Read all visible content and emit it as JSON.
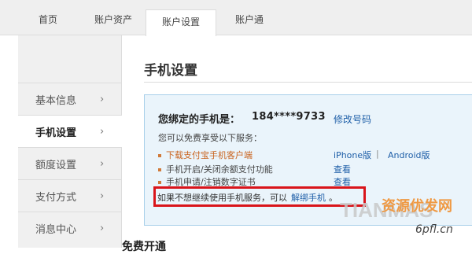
{
  "topnav": {
    "tabs": [
      {
        "label": "首页",
        "active": false
      },
      {
        "label": "账户资产",
        "active": false
      },
      {
        "label": "账户设置",
        "active": true
      },
      {
        "label": "账户通",
        "active": false
      }
    ]
  },
  "sidebar": {
    "items": [
      {
        "label": "基本信息",
        "active": false
      },
      {
        "label": "手机设置",
        "active": true
      },
      {
        "label": "额度设置",
        "active": false
      },
      {
        "label": "支付方式",
        "active": false
      },
      {
        "label": "消息中心",
        "active": false
      }
    ],
    "chevron": "›"
  },
  "main": {
    "title": "手机设置",
    "bound_label": "您绑定的手机是：",
    "phone": "184****9733",
    "modify_link": "修改号码",
    "free_intro": "您可以免费享受以下服务：",
    "services": [
      {
        "text": "下载支付宝手机客户端",
        "links": [
          "iPhone版",
          "Android版"
        ]
      },
      {
        "text": "手机开启/关闭余额支付功能",
        "links": [
          "查看"
        ]
      },
      {
        "text": "手机申请/注销数字证书",
        "links": [
          "查看"
        ]
      }
    ],
    "link_separator": "|",
    "unbind_text": "如果不想继续使用手机服务，可以",
    "unbind_link": "解绑手机",
    "unbind_stop": "。",
    "section_heading": "免费开通"
  },
  "watermark": {
    "brand_text": "TIANMAS",
    "cn_text": "资源优发网",
    "domain_text": "6pfl.cn"
  },
  "colors": {
    "highlight": "#d9141a",
    "link": "#1f5fa8",
    "info_bg": "#eaf4fb"
  }
}
